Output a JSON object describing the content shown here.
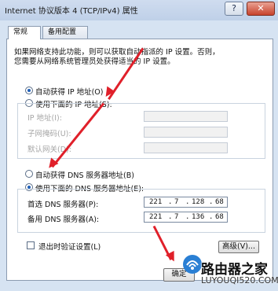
{
  "window": {
    "title": "Internet 协议版本 4 (TCP/IPv4) 属性",
    "help_glyph": "?",
    "close_glyph": "✕"
  },
  "tabs": [
    {
      "label": "常规",
      "selected": true
    },
    {
      "label": "备用配置",
      "selected": false
    }
  ],
  "description": {
    "line1": "如果网络支持此功能，则可以获取自动指派的 IP 设置。否则，",
    "line2": "您需要从网络系统管理员处获得适当的 IP 设置。"
  },
  "ip_options": {
    "auto_label": "自动获得 IP 地址(O)",
    "auto_selected": true,
    "manual_label": "使用下面的 IP 地址(S):",
    "manual_selected": false,
    "fields": [
      {
        "label": "IP 地址(I):",
        "value": ""
      },
      {
        "label": "子网掩码(U):",
        "value": ""
      },
      {
        "label": "默认网关(D):",
        "value": ""
      }
    ]
  },
  "dns_options": {
    "auto_label": "自动获得 DNS 服务器地址(B)",
    "auto_selected": false,
    "manual_label": "使用下面的 DNS 服务器地址(E):",
    "manual_selected": true,
    "fields": [
      {
        "label": "首选 DNS 服务器(P):",
        "octets": [
          "221",
          "7",
          "128",
          "68"
        ]
      },
      {
        "label": "备用 DNS 服务器(A):",
        "octets": [
          "221",
          "7",
          "136",
          "68"
        ]
      }
    ]
  },
  "validate_on_exit": {
    "label": "退出时验证设置(L)",
    "checked": false
  },
  "buttons": {
    "advanced": "高级(V)...",
    "ok": "确定"
  },
  "watermark": {
    "text": "路由器之家",
    "url": "LUYOUQI520.COM"
  },
  "colors": {
    "annotation_arrow": "#e0202a",
    "selection": "#1f5fb8"
  }
}
